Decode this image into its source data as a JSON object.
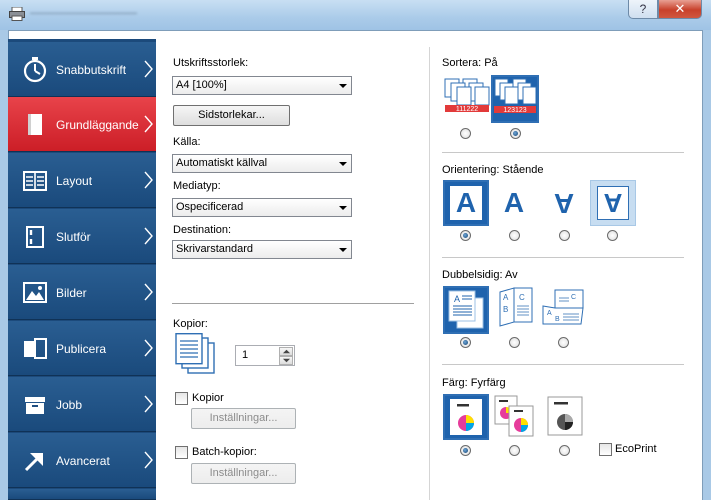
{
  "window": {
    "help_label": "?",
    "close_label": "✕"
  },
  "nav": [
    {
      "label": "Snabbutskrift",
      "icon": "stopwatch-icon"
    },
    {
      "label": "Grundläggande",
      "icon": "page-icon"
    },
    {
      "label": "Layout",
      "icon": "layout-icon"
    },
    {
      "label": "Slutför",
      "icon": "staple-icon"
    },
    {
      "label": "Bilder",
      "icon": "image-icon"
    },
    {
      "label": "Publicera",
      "icon": "publish-icon"
    },
    {
      "label": "Jobb",
      "icon": "job-box-icon"
    },
    {
      "label": "Avancerat",
      "icon": "arrow-icon"
    }
  ],
  "basic": {
    "print_size_label": "Utskriftsstorlek:",
    "print_size_value": "A4  [100%]",
    "page_sizes_button": "Sidstorlekar...",
    "source_label": "Källa:",
    "source_value": "Automatiskt källval",
    "media_label": "Mediatyp:",
    "media_value": "Ospecificerad",
    "destination_label": "Destination:",
    "destination_value": "Skrivarstandard",
    "copies_label": "Kopior:",
    "copies_value": "1",
    "copies_checkbox_label": "Kopior",
    "copies_settings_button": "Inställningar...",
    "batch_checkbox_label": "Batch-kopior:",
    "batch_settings_button": "Inställningar..."
  },
  "collate": {
    "label": "Sortera:",
    "value": "På",
    "sheet_a": "111222",
    "sheet_b": "123123"
  },
  "orientation": {
    "label": "Orientering:",
    "value": "Stående",
    "glyph": "A"
  },
  "duplex": {
    "label": "Dubbelsidig:",
    "value": "Av"
  },
  "color": {
    "label": "Färg:",
    "value": "Fyrfärg",
    "ecoprint_label": "EcoPrint"
  },
  "colors": {
    "accent": "#2f6fb4",
    "nav_bg": "#1f4e80",
    "nav_active": "#d8262e"
  }
}
